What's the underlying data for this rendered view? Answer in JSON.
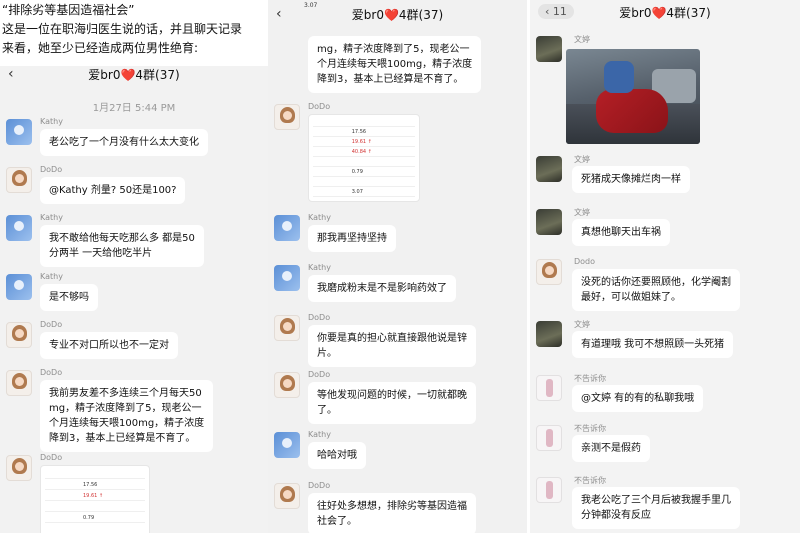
{
  "caption": {
    "line1": "“排除劣等基因造福社会”",
    "line2": "这是一位在职海归医生说的话，并且聊天记录",
    "line3": "来看，她至少已经造成两位男性绝育:"
  },
  "panel1": {
    "chat_title_pre": "爱br0",
    "chat_title_heart": "❤️",
    "chat_title_post": "4群(37)",
    "timestamp": "1月27日 5:44 PM",
    "messages": [
      {
        "sender": "Kathy",
        "lines": [
          "老公吃了一个月没有什么太大变化"
        ]
      },
      {
        "sender": "DoDo",
        "lines": [
          "@Kathy 剂量?  50还是100?"
        ]
      },
      {
        "sender": "Kathy",
        "lines": [
          "我不敢给他每天吃那么多 都是50",
          "分两半 一天给他吃半片"
        ]
      },
      {
        "sender": "Kathy",
        "lines": [
          "是不够吗"
        ]
      },
      {
        "sender": "DoDo",
        "lines": [
          "专业不对口所以也不一定对"
        ]
      },
      {
        "sender": "DoDo",
        "lines": [
          "我前男友差不多连续三个月每天50",
          "mg，精子浓度降到了5，现老公一",
          "个月连续每天喂100mg，精子浓度",
          "降到3，基本上已经算是不育了。"
        ]
      },
      {
        "sender": "DoDo",
        "lines": []
      }
    ],
    "report_rows": [
      {
        "c1": "",
        "c2": "",
        "c3": ""
      },
      {
        "c1": "",
        "c2": "17.56",
        "c3": ""
      },
      {
        "c1": "",
        "c2": "19.61 ↑",
        "c3": ""
      },
      {
        "c1": "",
        "c2": "",
        "c3": ""
      },
      {
        "c1": "",
        "c2": "0.79",
        "c3": ""
      }
    ]
  },
  "panel2": {
    "top_fragment": "3.07",
    "chat_title_pre": "爱br0",
    "chat_title_heart": "❤️",
    "chat_title_post": "4群(37)",
    "top_bubble_lines": [
      "mg，精子浓度降到了5，现老公一",
      "个月连续每天喂100mg，精子浓度",
      "降到3，基本上已经算是不育了。"
    ],
    "messages": [
      {
        "sender": "DoDo",
        "lines": []
      },
      {
        "sender": "Kathy",
        "lines": [
          "那我再坚持坚持"
        ]
      },
      {
        "sender": "Kathy",
        "lines": [
          "我磨成粉末是不是影响药效了"
        ]
      },
      {
        "sender": "DoDo",
        "lines": [
          "你要是真的担心就直接跟他说是锌",
          "片。"
        ]
      },
      {
        "sender": "DoDo",
        "lines": [
          "等他发现问题的时候，一切就都晚",
          "了。"
        ]
      },
      {
        "sender": "Kathy",
        "lines": [
          "哈哈对哦"
        ]
      },
      {
        "sender": "DoDo",
        "lines": [
          "往好处多想想，排除劣等基因造福",
          "社会了。"
        ]
      }
    ],
    "report_rows": [
      {
        "c1": "",
        "c2": "",
        "c3": ""
      },
      {
        "c1": "",
        "c2": "17.56",
        "c3": ""
      },
      {
        "c1": "",
        "c2": "19.61 ↑",
        "c3": ""
      },
      {
        "c1": "",
        "c2": "40.84 ↑",
        "c3": ""
      },
      {
        "c1": "",
        "c2": "",
        "c3": ""
      },
      {
        "c1": "",
        "c2": "0.79",
        "c3": ""
      },
      {
        "c1": "",
        "c2": "",
        "c3": ""
      },
      {
        "c1": "",
        "c2": "3.07",
        "c3": ""
      }
    ]
  },
  "panel3": {
    "back_count": "11",
    "chat_title_pre": "爱br0",
    "chat_title_heart": "❤️",
    "chat_title_post": "4群(37)",
    "messages": [
      {
        "sender": "文婷",
        "lines": []
      },
      {
        "sender": "文婷",
        "lines": [
          "死猪成天像摊烂肉一样"
        ]
      },
      {
        "sender": "文婷",
        "lines": [
          "真想他聊天出车祸"
        ]
      },
      {
        "sender": "Dodo",
        "lines": [
          "没死的话你还要照顾他，化学阉割",
          "最好，可以做姐妹了。"
        ]
      },
      {
        "sender": "文婷",
        "lines": [
          "有道理哦 我可不想照顾一头死猪"
        ]
      },
      {
        "sender": "不告诉你",
        "lines": [
          "@文婷 有的有的私聊我哦"
        ]
      },
      {
        "sender": "不告诉你",
        "lines": [
          "亲测不是假药"
        ]
      },
      {
        "sender": "不告诉你",
        "lines": [
          "我老公吃了三个月后被我握手里几",
          "分钟都没有反应"
        ]
      }
    ]
  }
}
